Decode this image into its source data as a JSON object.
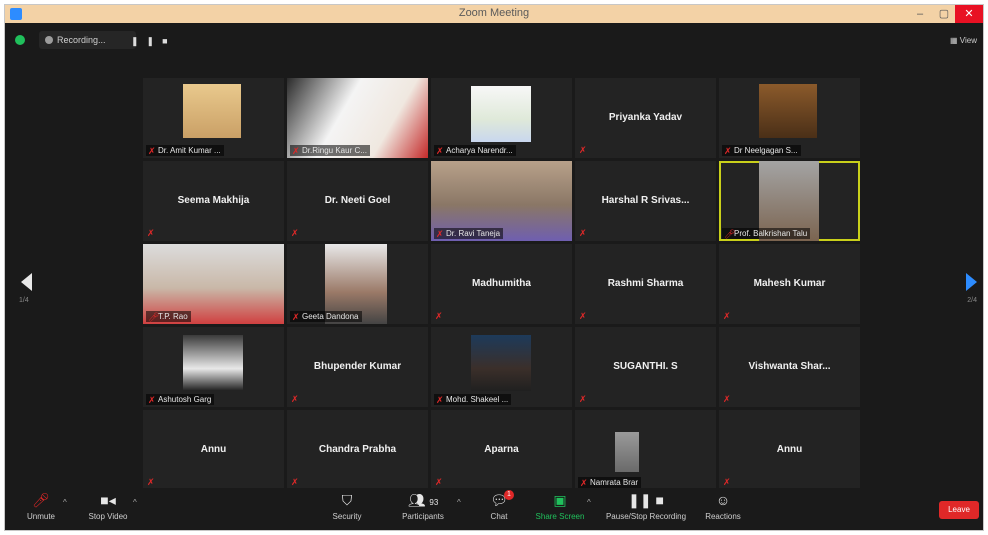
{
  "window": {
    "title": "Zoom Meeting"
  },
  "topbar": {
    "recording_label": "Recording...",
    "view_label": "View"
  },
  "gallery": {
    "page_left": "1/4",
    "page_right": "2/4",
    "tiles": [
      {
        "name": "Dr. Amit Kumar ...",
        "video": true,
        "muted": true
      },
      {
        "name": "Dr.Ringu Kaur C...",
        "video": true,
        "muted": true
      },
      {
        "name": "Acharya Narendr...",
        "video": true,
        "muted": true
      },
      {
        "name": "Priyanka Yadav",
        "video": false,
        "muted": true
      },
      {
        "name": "Dr Neelgagan S...",
        "video": true,
        "muted": true
      },
      {
        "name": "Seema Makhija",
        "video": false,
        "muted": true
      },
      {
        "name": "Dr. Neeti Goel",
        "video": false,
        "muted": true
      },
      {
        "name": "Dr. Ravi Taneja",
        "video": true,
        "muted": true
      },
      {
        "name": "Harshal R Srivas...",
        "video": false,
        "muted": true
      },
      {
        "name": "Prof. Balkrishan Talu",
        "video": true,
        "muted": false,
        "active": true
      },
      {
        "name": "T.P. Rao",
        "video": true,
        "muted": false
      },
      {
        "name": "Geeta Dandona",
        "video": true,
        "muted": true
      },
      {
        "name": "Madhumitha",
        "video": false,
        "muted": true
      },
      {
        "name": "Rashmi Sharma",
        "video": false,
        "muted": true
      },
      {
        "name": "Mahesh Kumar",
        "video": false,
        "muted": true
      },
      {
        "name": "Ashutosh Garg",
        "video": true,
        "muted": true
      },
      {
        "name": "Bhupender Kumar",
        "video": false,
        "muted": true
      },
      {
        "name": "Mohd. Shakeel ...",
        "video": true,
        "muted": true
      },
      {
        "name": "SUGANTHI. S",
        "video": false,
        "muted": true
      },
      {
        "name": "Vishwanta Shar...",
        "video": false,
        "muted": true
      },
      {
        "name": "Annu",
        "video": false,
        "muted": true
      },
      {
        "name": "Chandra Prabha",
        "video": false,
        "muted": true
      },
      {
        "name": "Aparna",
        "video": false,
        "muted": true
      },
      {
        "name": "Namrata Brar",
        "video": true,
        "muted": true
      },
      {
        "name": "Annu",
        "video": false,
        "muted": true
      }
    ]
  },
  "toolbar": {
    "unmute": "Unmute",
    "stop_video": "Stop Video",
    "security": "Security",
    "participants": "Participants",
    "participants_count": "93",
    "chat": "Chat",
    "chat_badge": "1",
    "share_screen": "Share Screen",
    "pause_recording": "Pause/Stop Recording",
    "reactions": "Reactions",
    "leave": "Leave"
  },
  "colors": {
    "accent": "#2d8cff",
    "muted_red": "#e02828",
    "active_outline": "#c9d01a",
    "leave_red": "#e02828"
  }
}
